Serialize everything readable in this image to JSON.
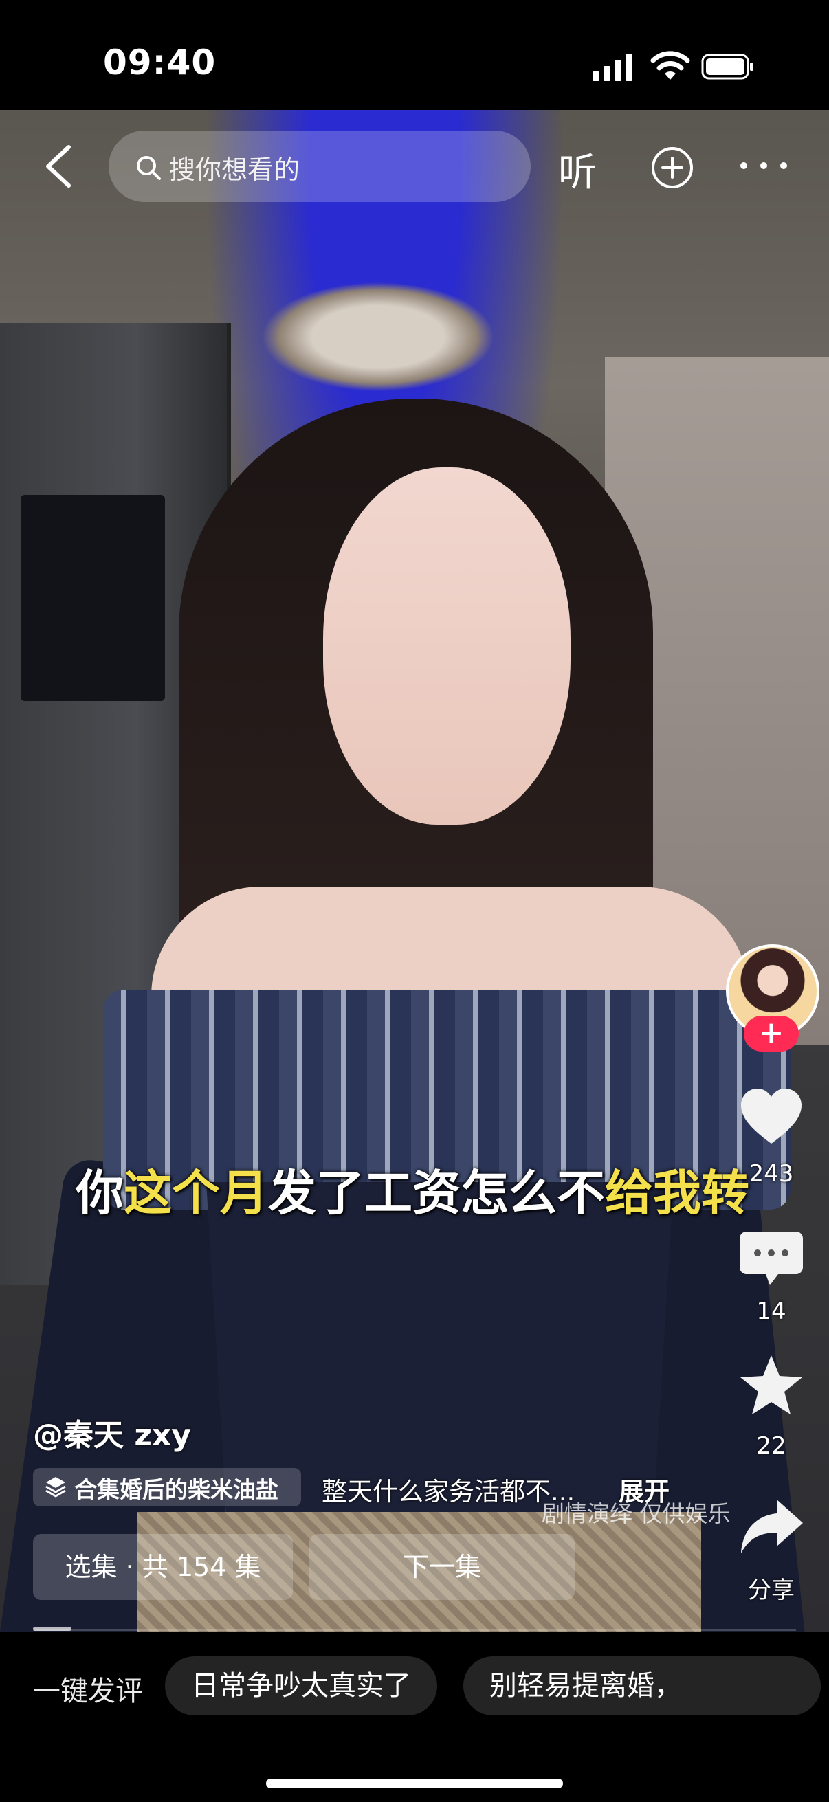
{
  "status_bar": {
    "time": "09:40"
  },
  "top_bar": {
    "search_placeholder": "搜你想看的",
    "listen_label": "听"
  },
  "subtitle": {
    "parts": [
      {
        "text": "你",
        "highlight": false
      },
      {
        "text": "这个月",
        "highlight": true
      },
      {
        "text": "发了工资怎么不",
        "highlight": false
      },
      {
        "text": "给我转",
        "highlight": true
      }
    ]
  },
  "actions": {
    "likes": "243",
    "comments": "14",
    "favorites": "22",
    "share_label": "分享"
  },
  "video_info": {
    "author": "@秦天 zxy",
    "collection": "合集婚后的柴米油盐",
    "description": "整天什么家务活都不...",
    "expand_label": "展开",
    "disclaimer": "剧情演绎 仅供娱乐"
  },
  "episodes": {
    "select_label": "选集 · 共 154 集",
    "next_label": "下一集",
    "progress": 0.05
  },
  "comment_bar": {
    "quick_label": "一键发评",
    "chips": [
      "日常争吵太真实了",
      "别轻易提离婚，"
    ]
  },
  "colors": {
    "highlight_yellow": "#f4e04a",
    "follow_red": "#ff2b55"
  }
}
